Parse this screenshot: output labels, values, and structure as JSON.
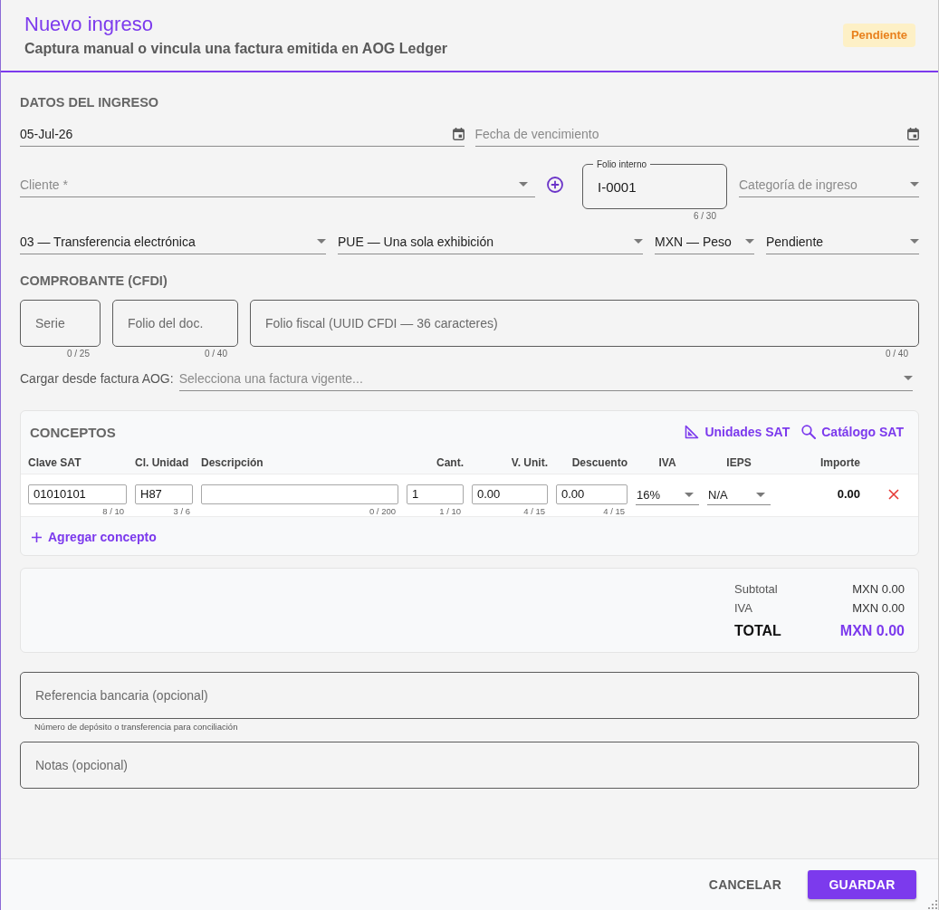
{
  "dialog": {
    "title": "Nuevo ingreso",
    "subtitle": "Captura manual o vincula una factura emitida en AOG Ledger",
    "status_badge": "Pendiente"
  },
  "datos": {
    "heading": "DATOS DEL INGRESO",
    "groups": [
      {
        "fields": [
          {
            "kind": "date",
            "value": "05-Jul-26"
          },
          {
            "kind": "date",
            "placeholder": "Fecha de vencimiento"
          }
        ]
      },
      {
        "fields": [
          {
            "kind": "select",
            "placeholder": "Cliente *",
            "add_button": true
          },
          {
            "kind": "outlined",
            "label": "Folio interno",
            "value": "I-0001",
            "counter": "6 / 30"
          },
          {
            "kind": "select",
            "placeholder": "Categoría de ingreso"
          }
        ]
      },
      {
        "fields": [
          {
            "kind": "select",
            "value": "03 — Transferencia electrónica"
          },
          {
            "kind": "select",
            "value": "PUE — Una sola exhibición"
          },
          {
            "kind": "select",
            "value": "MXN — Peso"
          },
          {
            "kind": "select",
            "value": "Pendiente"
          }
        ]
      }
    ]
  },
  "comprobante": {
    "heading": "COMPROBANTE (CFDI)",
    "fields": [
      {
        "kind": "outlined",
        "placeholder": "Serie",
        "counter": "0 / 25"
      },
      {
        "kind": "outlined",
        "placeholder": "Folio del doc.",
        "counter": "0 / 40"
      },
      {
        "kind": "outlined",
        "placeholder": "Folio fiscal (UUID CFDI — 36 caracteres)",
        "counter": "0 / 40"
      }
    ],
    "load_from_invoice": {
      "label": "Cargar desde factura AOG:",
      "field": {
        "kind": "select",
        "placeholder": "Selecciona una factura vigente..."
      }
    }
  },
  "conceptos": {
    "heading": "CONCEPTOS",
    "links": [
      {
        "kind": "units",
        "label": "Unidades SAT"
      },
      {
        "kind": "catalog",
        "label": "Catálogo SAT"
      }
    ],
    "columns": [
      "Clave SAT",
      "Cl. Unidad",
      "Descripción",
      "Cant.",
      "V. Unit.",
      "Descuento",
      "IVA",
      "IEPS",
      "Importe"
    ],
    "rows": [
      {
        "cells": [
          {
            "kind": "input",
            "value": "01010101",
            "counter": "8 / 10"
          },
          {
            "kind": "input",
            "value": "H87",
            "counter": "3 / 6"
          },
          {
            "kind": "input",
            "counter": "0 / 200"
          },
          {
            "kind": "input",
            "value": "1",
            "counter": "1 / 10"
          },
          {
            "kind": "input",
            "value": "0.00",
            "counter": "4 / 15"
          },
          {
            "kind": "input",
            "value": "0.00",
            "counter": "4 / 15"
          },
          {
            "kind": "select",
            "value": "16%"
          },
          {
            "kind": "select",
            "value": "N/A"
          },
          {
            "kind": "amount",
            "value": "0.00"
          }
        ]
      }
    ],
    "add_button": "Agregar concepto"
  },
  "totals": [
    {
      "kind": "line",
      "label": "Subtotal",
      "value": "MXN 0.00"
    },
    {
      "kind": "line",
      "label": "IVA",
      "value": "MXN 0.00"
    },
    {
      "kind": "grand",
      "label": "TOTAL",
      "value": "MXN 0.00"
    }
  ],
  "referencia": {
    "kind": "outlined",
    "placeholder": "Referencia bancaria (opcional)",
    "hint": "Número de depósito o transferencia para conciliación"
  },
  "notas": {
    "kind": "outlined",
    "placeholder": "Notas (opcional)"
  },
  "footer": {
    "buttons": [
      {
        "kind": "text",
        "label": "CANCELAR"
      },
      {
        "kind": "primary",
        "label": "GUARDAR"
      }
    ]
  }
}
